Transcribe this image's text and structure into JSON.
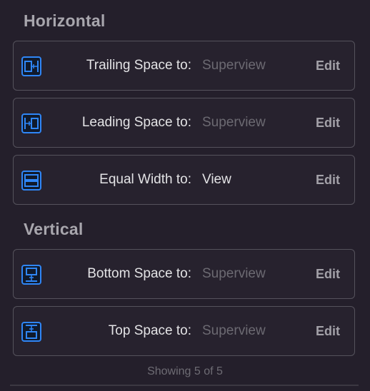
{
  "sections": {
    "horizontal": "Horizontal",
    "vertical": "Vertical"
  },
  "rows": [
    {
      "label": "Trailing Space to:",
      "target": "Superview",
      "edit": "Edit",
      "icon": "trailing-space-icon"
    },
    {
      "label": "Leading Space to:",
      "target": "Superview",
      "edit": "Edit",
      "icon": "leading-space-icon"
    },
    {
      "label": "Equal Width to:",
      "target": "View",
      "edit": "Edit",
      "icon": "equal-width-icon"
    },
    {
      "label": "Bottom Space to:",
      "target": "Superview",
      "edit": "Edit",
      "icon": "bottom-space-icon"
    },
    {
      "label": "Top Space to:",
      "target": "Superview",
      "edit": "Edit",
      "icon": "top-space-icon"
    }
  ],
  "footer": "Showing 5 of 5",
  "colors": {
    "background": "#241f2b",
    "icon_accent": "#2f86f6",
    "muted_text": "#6c6a72"
  }
}
